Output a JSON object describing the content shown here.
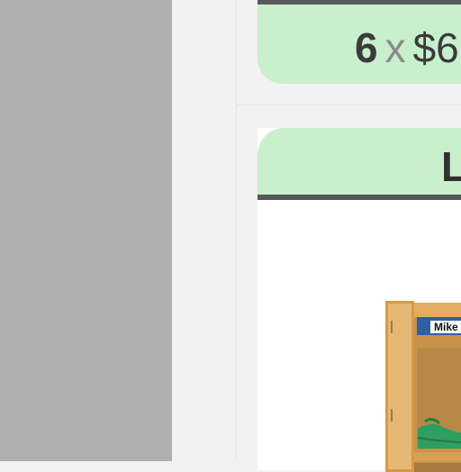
{
  "price_card": {
    "quantity": "6",
    "times": "x",
    "price_partial": "$6"
  },
  "product_card": {
    "header_letter": "L",
    "product_image": {
      "name_tag": "Mike"
    }
  },
  "colors": {
    "sidebar_gray": "#afafaf",
    "page_bg": "#f2f2f2",
    "card_green": "#c8f0cd",
    "card_rule": "#55575a"
  }
}
